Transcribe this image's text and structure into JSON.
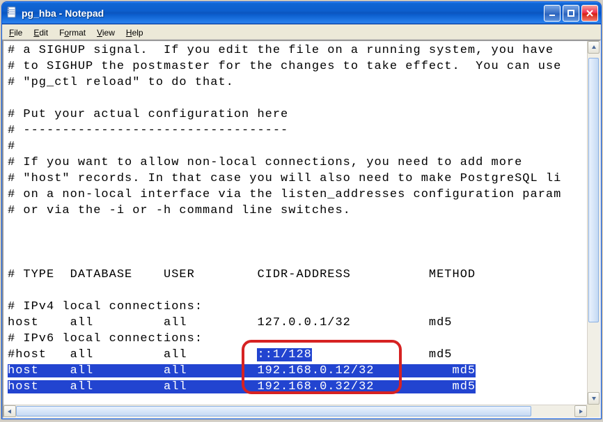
{
  "window": {
    "title": "pg_hba - Notepad"
  },
  "menu": {
    "file": "File",
    "edit": "Edit",
    "format": "Format",
    "view": "View",
    "help": "Help"
  },
  "content": {
    "line01": "# a SIGHUP signal.  If you edit the file on a running system, you have",
    "line02": "# to SIGHUP the postmaster for the changes to take effect.  You can use",
    "line03": "# \"pg_ctl reload\" to do that.",
    "line04": "",
    "line05": "# Put your actual configuration here",
    "line06": "# ----------------------------------",
    "line07": "#",
    "line08": "# If you want to allow non-local connections, you need to add more",
    "line09": "# \"host\" records. In that case you will also need to make PostgreSQL li",
    "line10": "# on a non-local interface via the listen_addresses configuration param",
    "line11": "# or via the -i or -h command line switches.",
    "line12": "",
    "line13": "",
    "line14": "",
    "line15": "# TYPE  DATABASE    USER        CIDR-ADDRESS          METHOD",
    "line16": "",
    "line17": "# IPv4 local connections:",
    "line18": "host    all         all         127.0.0.1/32          md5",
    "line19": "# IPv6 local connections:",
    "line20_a": "#host   all         all         ",
    "line20_b": "::1/128",
    "line20_c": "               md5",
    "sel21": "host    all         all         192.168.0.12/32          md5",
    "sel22": "host    all         all         192.168.0.32/32          md5"
  }
}
